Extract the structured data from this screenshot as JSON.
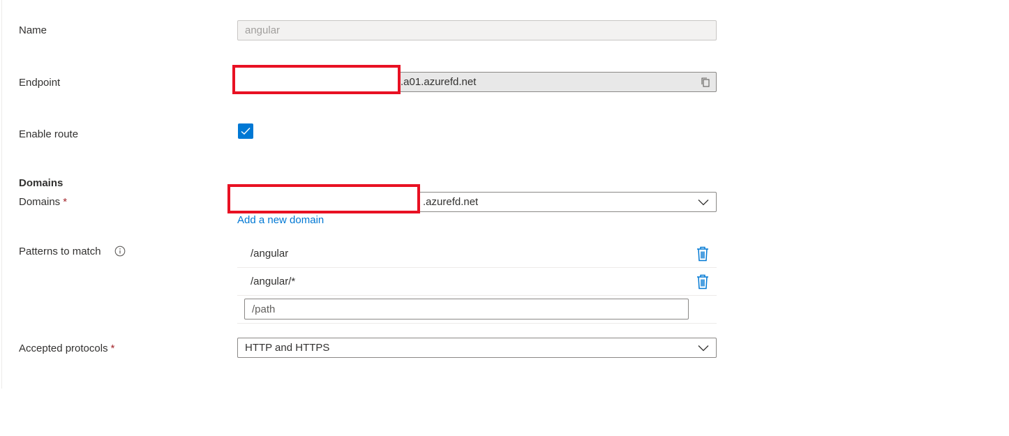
{
  "form": {
    "name": {
      "label": "Name",
      "value": "angular"
    },
    "endpoint": {
      "label": "Endpoint",
      "value_suffix": ".a01.azurefd.net",
      "copy_icon": "copy-icon"
    },
    "enable_route": {
      "label": "Enable route",
      "checked": true
    },
    "domains_section": {
      "title": "Domains"
    },
    "domains": {
      "label": "Domains",
      "required_mark": "*",
      "value_suffix": ".azurefd.net",
      "add_link": "Add a new domain"
    },
    "patterns": {
      "label": "Patterns to match",
      "info_icon": "info-icon",
      "items": [
        "/angular",
        "/angular/*"
      ],
      "input_placeholder": "/path"
    },
    "protocols": {
      "label": "Accepted protocols",
      "required_mark": "*",
      "value": "HTTP and HTTPS"
    }
  },
  "colors": {
    "accent": "#0078d4",
    "required": "#a4262c",
    "redaction": "#e81123"
  }
}
